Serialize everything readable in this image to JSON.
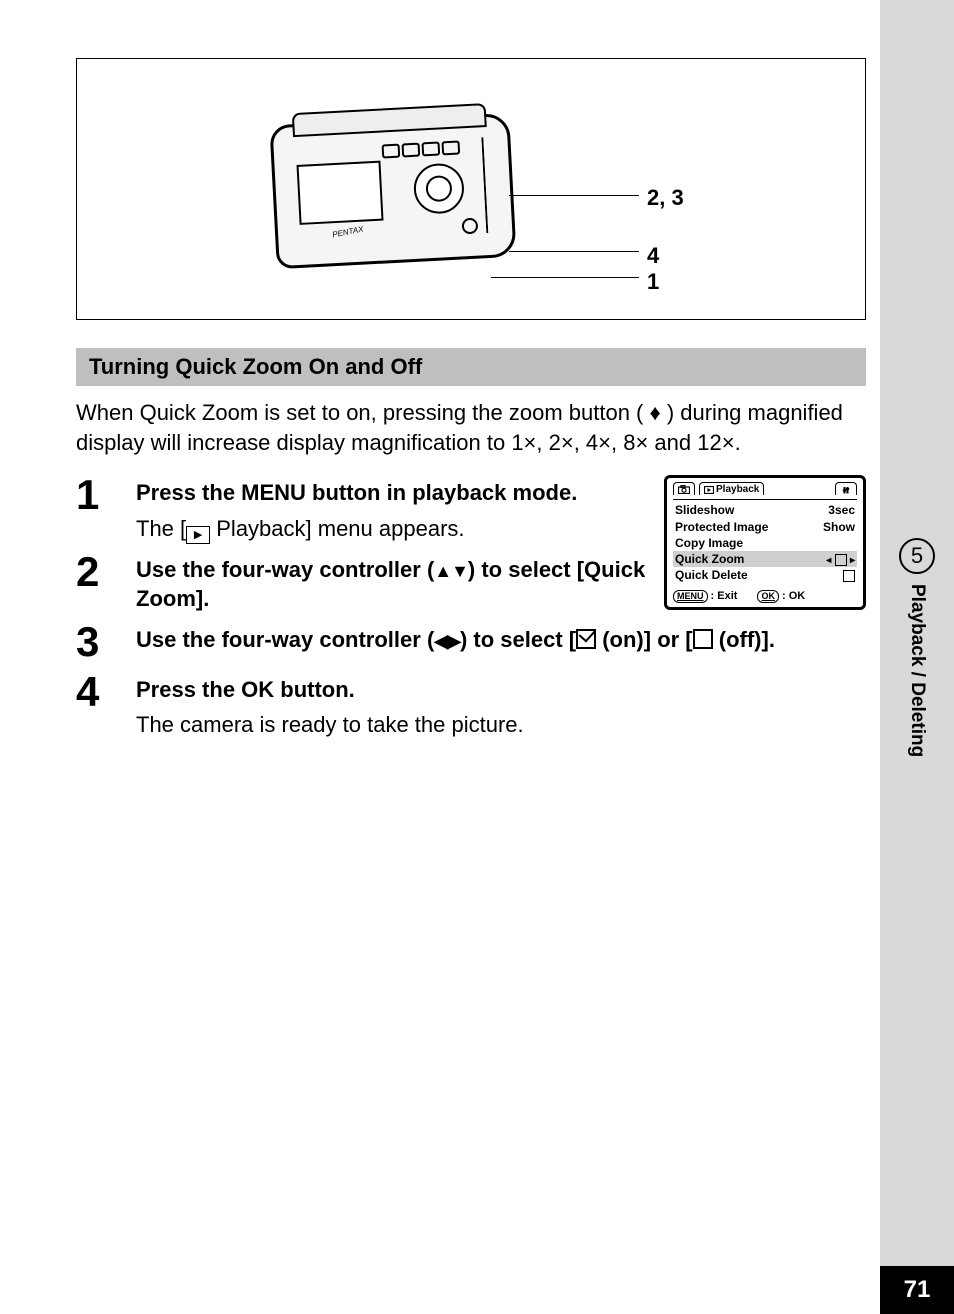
{
  "figure": {
    "brand": "PENTAX",
    "callouts": {
      "c23": "2, 3",
      "c4": "4",
      "c1": "1"
    }
  },
  "section_title": "Turning Quick Zoom On and Off",
  "intro": "When Quick Zoom is set to on, pressing the zoom button ( ♦ ) during magnified display will increase display magnification to 1×, 2×, 4×, 8× and 12×.",
  "steps": {
    "s1": {
      "num": "1",
      "title": "Press the MENU button in playback mode.",
      "detail_before": "The [",
      "detail_after": " Playback] menu appears."
    },
    "s2": {
      "num": "2",
      "title_before": "Use the four-way controller (",
      "title_arrows": "▲▼",
      "title_after": ") to select [Quick Zoom]."
    },
    "s3": {
      "num": "3",
      "title_before": "Use the four-way controller (",
      "title_arrows": "◀▶",
      "title_mid": ") to select [",
      "on_label": " (on)] or [",
      "off_label": " (off)]."
    },
    "s4": {
      "num": "4",
      "title": "Press the OK button.",
      "detail": "The camera is ready to take the picture."
    }
  },
  "menu_screenshot": {
    "header_playback": "Playback",
    "rows": {
      "slideshow": {
        "label": "Slideshow",
        "value": "3sec"
      },
      "protected": {
        "label": "Protected Image",
        "value": "Show"
      },
      "copy": {
        "label": "Copy Image"
      },
      "quickzoom": {
        "label": "Quick Zoom"
      },
      "quickdelete": {
        "label": "Quick Delete"
      }
    },
    "footer": {
      "menu_pill": "MENU",
      "exit": "Exit",
      "ok_pill": "OK",
      "ok": "OK"
    }
  },
  "side": {
    "chapter_num": "5",
    "chapter_label": "Playback / Deleting",
    "page_num": "71"
  }
}
